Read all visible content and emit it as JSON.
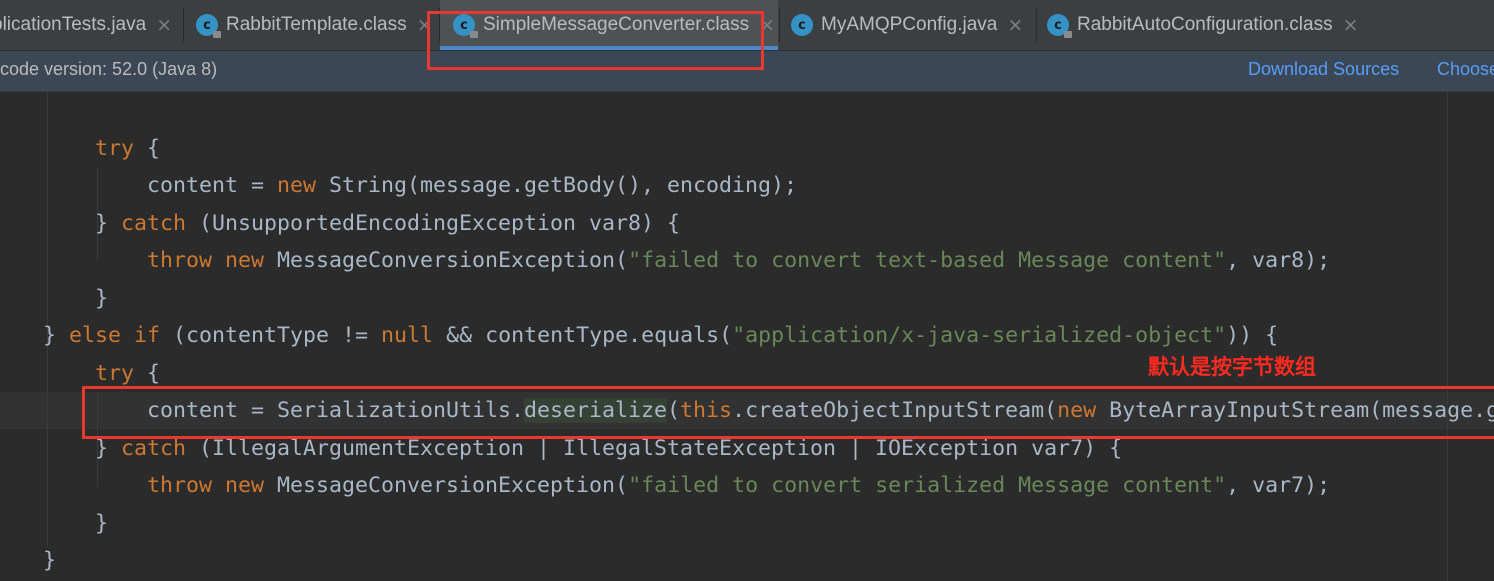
{
  "tabs": [
    {
      "label": "plicationTests.java",
      "icon": "java-class-icon"
    },
    {
      "label": "RabbitTemplate.class",
      "icon": "class-file-icon"
    },
    {
      "label": "SimpleMessageConverter.class",
      "icon": "class-file-icon",
      "active": true
    },
    {
      "label": "MyAMQPConfig.java",
      "icon": "java-class-icon"
    },
    {
      "label": "RabbitAutoConfiguration.class",
      "icon": "class-file-icon"
    }
  ],
  "tab_icon_letter": "c",
  "close_glyph": "×",
  "banner": {
    "text": "code version: 52.0 (Java 8)",
    "download_sources": "Download Sources",
    "choose_sources": "Choose"
  },
  "code": {
    "l1": {
      "kw": "try",
      "rest": " {"
    },
    "l2": {
      "pre": "content = ",
      "kw": "new",
      "post": " String(message.getBody(), encoding);"
    },
    "l3": {
      "pre": "} ",
      "kw": "catch",
      "post": " (UnsupportedEncodingException var8) {"
    },
    "l4": {
      "kw1": "throw",
      "sp": " ",
      "kw2": "new",
      "mid": " MessageConversionException(",
      "str": "\"failed to convert text-based Message content\"",
      "post": ", var8);"
    },
    "l5": {
      "text": "}"
    },
    "l6": {
      "pre": "} ",
      "kw1": "else if",
      "mid1": " (contentType != ",
      "kw2": "null",
      "mid2": " && contentType.equals(",
      "str": "\"application/x-java-serialized-object\"",
      "post": ")) {"
    },
    "l7": {
      "kw": "try",
      "rest": " {"
    },
    "l8": {
      "pre": "content = SerializationUtils.",
      "hl": "deserialize",
      "mid": "(",
      "kw1": "this",
      "mid2": ".createObjectInputStream(",
      "kw2": "new",
      "post": " ByteArrayInputStream(message.g"
    },
    "l9": {
      "pre": "} ",
      "kw": "catch",
      "post": " (IllegalArgumentException | IllegalStateException | IOException var7) {"
    },
    "l10": {
      "kw1": "throw",
      "sp": " ",
      "kw2": "new",
      "mid": " MessageConversionException(",
      "str": "\"failed to convert serialized Message content\"",
      "post": ", var7);"
    },
    "l11": {
      "text": "}"
    },
    "l12": {
      "text": "}"
    }
  },
  "annotation": {
    "note": "默认是按字节数组",
    "color": "#e8382f"
  }
}
